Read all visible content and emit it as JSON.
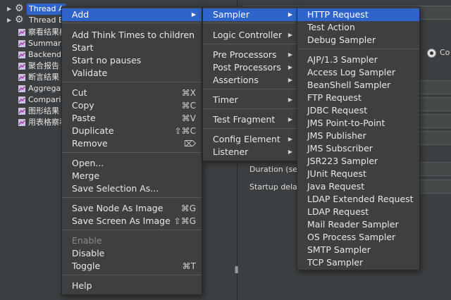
{
  "tree": {
    "items": [
      {
        "label": "Thread A",
        "kind": "thread",
        "selected": true
      },
      {
        "label": "Thread Be",
        "kind": "thread",
        "selected": false
      },
      {
        "label": "察看结果树",
        "kind": "listener"
      },
      {
        "label": "Summary",
        "kind": "listener"
      },
      {
        "label": "Backend",
        "kind": "listener"
      },
      {
        "label": "聚合报告",
        "kind": "listener"
      },
      {
        "label": "断言结果",
        "kind": "listener"
      },
      {
        "label": "Aggregate",
        "kind": "listener"
      },
      {
        "label": "Comparis",
        "kind": "listener"
      },
      {
        "label": "图形结果",
        "kind": "listener"
      },
      {
        "label": "用表格察看",
        "kind": "listener"
      }
    ]
  },
  "background_panel": {
    "radio_label": "Co",
    "duration_label": "Duration (se",
    "startup_label": "Startup dela"
  },
  "context_menu": {
    "items": [
      {
        "label": "Add",
        "shortcut": "",
        "submenu": true,
        "highlighted": true
      },
      {
        "label": "Add Think Times to children",
        "shortcut": ""
      },
      {
        "label": "Start",
        "shortcut": ""
      },
      {
        "label": "Start no pauses",
        "shortcut": ""
      },
      {
        "label": "Validate",
        "shortcut": ""
      },
      {
        "label": "Cut",
        "shortcut": "⌘X"
      },
      {
        "label": "Copy",
        "shortcut": "⌘C"
      },
      {
        "label": "Paste",
        "shortcut": "⌘V"
      },
      {
        "label": "Duplicate",
        "shortcut": "⇧⌘C"
      },
      {
        "label": "Remove",
        "shortcut": "⌦"
      },
      {
        "label": "Open...",
        "shortcut": ""
      },
      {
        "label": "Merge",
        "shortcut": ""
      },
      {
        "label": "Save Selection As...",
        "shortcut": ""
      },
      {
        "label": "Save Node As Image",
        "shortcut": "⌘G"
      },
      {
        "label": "Save Screen As Image",
        "shortcut": "⇧⌘G"
      },
      {
        "label": "Enable",
        "shortcut": "",
        "disabled": true
      },
      {
        "label": "Disable",
        "shortcut": ""
      },
      {
        "label": "Toggle",
        "shortcut": "⌘T"
      },
      {
        "label": "Help",
        "shortcut": ""
      }
    ]
  },
  "add_menu": {
    "items": [
      {
        "label": "Sampler",
        "submenu": true,
        "highlighted": true
      },
      {
        "label": "Logic Controller",
        "submenu": true
      },
      {
        "label": "Pre Processors",
        "submenu": true
      },
      {
        "label": "Post Processors",
        "submenu": true
      },
      {
        "label": "Assertions",
        "submenu": true
      },
      {
        "label": "Timer",
        "submenu": true
      },
      {
        "label": "Test Fragment",
        "submenu": true
      },
      {
        "label": "Config Element",
        "submenu": true
      },
      {
        "label": "Listener",
        "submenu": true
      }
    ]
  },
  "sampler_menu": {
    "items": [
      {
        "label": "HTTP Request",
        "highlighted": true
      },
      {
        "label": "Test Action"
      },
      {
        "label": "Debug Sampler"
      },
      {
        "label": "AJP/1.3 Sampler"
      },
      {
        "label": "Access Log Sampler"
      },
      {
        "label": "BeanShell Sampler"
      },
      {
        "label": "FTP Request"
      },
      {
        "label": "JDBC Request"
      },
      {
        "label": "JMS Point-to-Point"
      },
      {
        "label": "JMS Publisher"
      },
      {
        "label": "JMS Subscriber"
      },
      {
        "label": "JSR223 Sampler"
      },
      {
        "label": "JUnit Request"
      },
      {
        "label": "Java Request"
      },
      {
        "label": "LDAP Extended Request"
      },
      {
        "label": "LDAP Request"
      },
      {
        "label": "Mail Reader Sampler"
      },
      {
        "label": "OS Process Sampler"
      },
      {
        "label": "SMTP Sampler"
      },
      {
        "label": "TCP Sampler"
      }
    ]
  },
  "colors": {
    "highlight": "#2f65ca",
    "menu_bg": "#3d3f41",
    "window_bg": "#3c3f41"
  }
}
